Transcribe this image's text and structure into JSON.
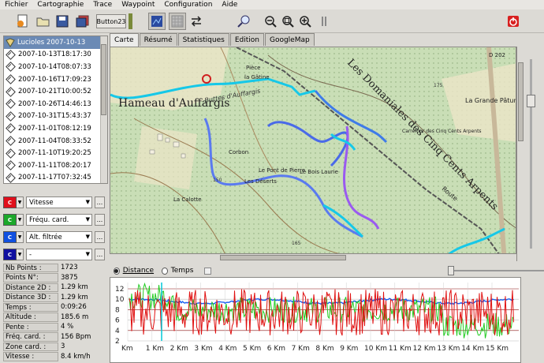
{
  "menu": [
    "Fichier",
    "Cartographie",
    "Trace",
    "Waypoint",
    "Configuration",
    "Aide"
  ],
  "toolbar": {
    "text_button": "Button23"
  },
  "tree": {
    "root": "Lucioles 2007-10-13",
    "items": [
      "2007-10-13T18:17:30",
      "2007-10-14T08:07:33",
      "2007-10-16T17:09:23",
      "2007-10-21T10:00:52",
      "2007-10-26T14:46:13",
      "2007-10-31T15:43:37",
      "2007-11-01T08:12:19",
      "2007-11-04T08:33:52",
      "2007-11-10T19:20:25",
      "2007-11-11T08:20:17",
      "2007-11-17T07:32:45"
    ]
  },
  "selectors": [
    {
      "color": "#e0101c",
      "label": "Vitesse"
    },
    {
      "color": "#1ca82a",
      "label": "Fréqu. card."
    },
    {
      "color": "#1050e0",
      "label": "Alt. filtrée"
    },
    {
      "color": "#1010a0",
      "label": "-"
    }
  ],
  "stats": [
    {
      "label": "Nb Points :",
      "value": "1723"
    },
    {
      "label": "Points N°:",
      "value": "3875"
    },
    {
      "label": "Distance 2D :",
      "value": "1.29 km"
    },
    {
      "label": "Distance 3D :",
      "value": "1.29 km"
    },
    {
      "label": "Temps :",
      "value": "0:09:26"
    },
    {
      "label": "Altitude :",
      "value": "185.6 m"
    },
    {
      "label": "Pente :",
      "value": "4 %"
    },
    {
      "label": "Fréq. card. :",
      "value": "156 Bpm"
    },
    {
      "label": "Zone card. :",
      "value": "3"
    },
    {
      "label": "Vitesse :",
      "value": "8.4 km/h"
    }
  ],
  "tabs": [
    "Carte",
    "Résumé",
    "Statistiques",
    "Edition",
    "GoogleMap"
  ],
  "map_labels": [
    "Les Domaniales des Cinq Cents Arpents",
    "Hameau d'Auffargis",
    "La Grande Pâture",
    "Le Bois Laurie",
    "Route",
    "la Gâtine",
    "Pièce",
    "Buttes d'Auffargis",
    "La Calotte",
    "Corbon",
    "Le Pont de Pierre",
    "Les Déserts",
    "Carrefour des Cinq Cents Arpents",
    "D 202",
    "175",
    "150",
    "165"
  ],
  "profile": {
    "mode_distance": "Distance",
    "mode_time": "Temps",
    "y_ticks": [
      "12",
      "10",
      "8",
      "6",
      "4",
      "2"
    ],
    "x_ticks": [
      "Km",
      "1 Km",
      "2 Km",
      "3 Km",
      "4 Km",
      "5 Km",
      "6 Km",
      "7 Km",
      "8 Km",
      "9 Km",
      "10 Km",
      "11 Km",
      "12 Km",
      "13 Km",
      "14 Km",
      "15 Km"
    ]
  },
  "colors": {
    "speed": "#e01010",
    "heart": "#22cc22",
    "altitude": "#1a5ef0",
    "cursor": "#00c8d8",
    "selection": "#6b8ab5"
  }
}
